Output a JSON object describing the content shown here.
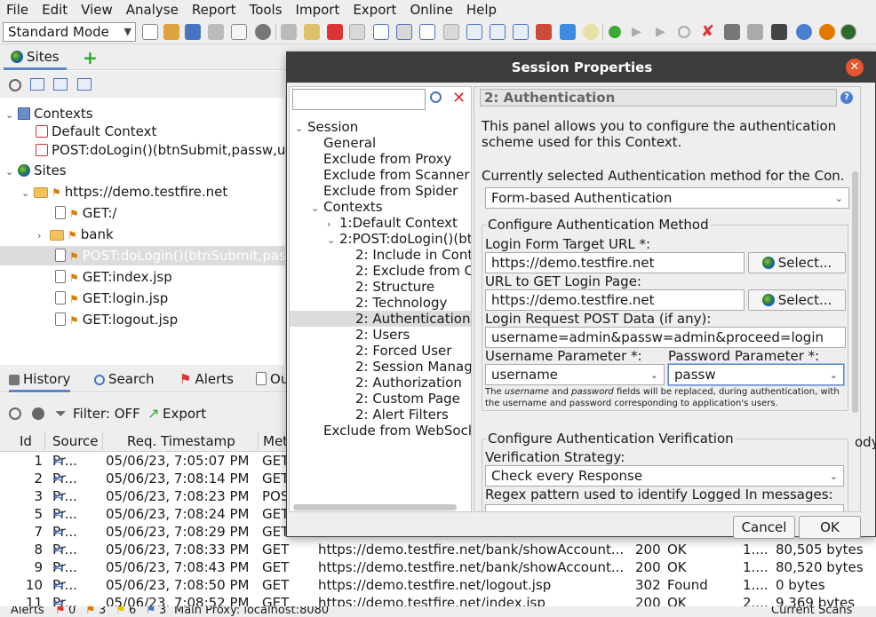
{
  "menubar": {
    "items": [
      "File",
      "Edit",
      "View",
      "Analyse",
      "Report",
      "Tools",
      "Import",
      "Export",
      "Online",
      "Help"
    ]
  },
  "toolbar": {
    "mode": "Standard Mode"
  },
  "sites": {
    "tab_label": "Sites",
    "tree": {
      "contexts": "Contexts",
      "default_context": "Default Context",
      "post_context": "POST:doLogin()(btnSubmit,passw,u",
      "sites": "Sites",
      "host": "https://demo.testfire.net",
      "get_root": "GET:/",
      "bank": "bank",
      "post_login": "POST:doLogin()(btnSubmit,pass",
      "get_index": "GET:index.jsp",
      "get_login": "GET:login.jsp",
      "get_logout": "GET:logout.jsp"
    }
  },
  "bottom": {
    "tabs": {
      "history": "History",
      "search": "Search",
      "alerts": "Alerts",
      "output": "Ou"
    },
    "filter_label": "Filter: OFF",
    "export_label": "Export",
    "columns": {
      "id": "Id",
      "source": "Source",
      "timestamp": "Req. Timestamp",
      "method": "Met"
    },
    "rows": [
      {
        "id": "1",
        "source": "Pr...",
        "ts": "05/06/23, 7:05:07 PM",
        "method": "GET",
        "url": "",
        "code": "",
        "status": "",
        "rtt": "",
        "size": ""
      },
      {
        "id": "2",
        "source": "Pr...",
        "ts": "05/06/23, 7:08:14 PM",
        "method": "GET",
        "url": "",
        "code": "",
        "status": "",
        "rtt": "",
        "size": ""
      },
      {
        "id": "3",
        "source": "Pr...",
        "ts": "05/06/23, 7:08:23 PM",
        "method": "POS",
        "url": "",
        "code": "",
        "status": "",
        "rtt": "",
        "size": ""
      },
      {
        "id": "5",
        "source": "Pr...",
        "ts": "05/06/23, 7:08:24 PM",
        "method": "GET",
        "url": "",
        "code": "",
        "status": "",
        "rtt": "",
        "size": ""
      },
      {
        "id": "7",
        "source": "Pr...",
        "ts": "05/06/23, 7:08:29 PM",
        "method": "GET",
        "url": "",
        "code": "",
        "status": "",
        "rtt": "",
        "size": ""
      },
      {
        "id": "8",
        "source": "Pr...",
        "ts": "05/06/23, 7:08:33 PM",
        "method": "GET",
        "url": "https://demo.testfire.net/bank/showAccount...",
        "code": "200",
        "status": "OK",
        "rtt": "1....",
        "size": "80,505 bytes"
      },
      {
        "id": "9",
        "source": "Pr...",
        "ts": "05/06/23, 7:08:43 PM",
        "method": "GET",
        "url": "https://demo.testfire.net/bank/showAccount...",
        "code": "200",
        "status": "OK",
        "rtt": "1....",
        "size": "80,520 bytes"
      },
      {
        "id": "10",
        "source": "Pr...",
        "ts": "05/06/23, 7:08:50 PM",
        "method": "GET",
        "url": "https://demo.testfire.net/logout.jsp",
        "code": "302",
        "status": "Found",
        "rtt": "1....",
        "size": "0 bytes"
      },
      {
        "id": "11",
        "source": "Pr...",
        "ts": "05/06/23, 7:08:52 PM",
        "method": "GET",
        "url": "https://demo.testfire.net/index.jsp",
        "code": "200",
        "status": "OK",
        "rtt": "2....",
        "size": "9,369 bytes"
      }
    ],
    "status_left": "Alerts",
    "status_counts": {
      "high": "0",
      "medium": "3",
      "low": "6",
      "info": "3"
    },
    "status_proxy": "Main Proxy: localhost:8080",
    "status_right": "Current Scans"
  },
  "dialog": {
    "title": "Session Properties",
    "tree": {
      "session": "Session",
      "general": "General",
      "excl_proxy": "Exclude from Proxy",
      "excl_scanner": "Exclude from Scanner",
      "excl_spider": "Exclude from Spider",
      "contexts": "Contexts",
      "ctx1": "1:Default Context",
      "ctx2": "2:POST:doLogin()(btn",
      "include": "2: Include in Conte",
      "exclude": "2: Exclude from C",
      "structure": "2: Structure",
      "technology": "2: Technology",
      "authentication": "2: Authentication",
      "users": "2: Users",
      "forced_user": "2: Forced User",
      "session_mgmt": "2: Session Manag",
      "authorization": "2: Authorization",
      "custom_page": "2: Custom Page",
      "alert_filters": "2: Alert Filters",
      "excl_websocket": "Exclude from WebSock"
    },
    "panel": {
      "title": "2: Authentication",
      "description": "This panel allows you to configure the authentication scheme used for this Context.",
      "current_method_label": "Currently selected Authentication method for the Con...",
      "method": "Form-based Authentication",
      "configure_method": "Configure Authentication Method",
      "login_target_label": "Login Form Target URL *:",
      "login_target_value": "https://demo.testfire.net",
      "select_btn": "Select...",
      "get_login_label": "URL to GET Login Page:",
      "get_login_value": "https://demo.testfire.net",
      "post_data_label": "Login Request POST Data (if any):",
      "post_data_value": "username=admin&passw=admin&proceed=login",
      "username_param_label": "Username Parameter *:",
      "username_param_value": "username",
      "password_param_label": "Password Parameter *:",
      "password_param_value": "passw",
      "note_part1": "The ",
      "note_username": "username",
      "note_part2": " and ",
      "note_password": "password",
      "note_part3": " fields will be replaced, during authentication, with the username and password corresponding to application's users.",
      "configure_verification": "Configure Authentication Verification",
      "verification_label": "Verification Strategy:",
      "verification_value": "Check every Response",
      "regex_label": "Regex pattern used to identify Logged In messages:",
      "right_cut": "ody"
    },
    "buttons": {
      "cancel": "Cancel",
      "ok": "OK"
    }
  },
  "colors": {
    "accent": "#5b86c6",
    "close": "#e9552d",
    "title_bar": "#3c3c3c"
  }
}
